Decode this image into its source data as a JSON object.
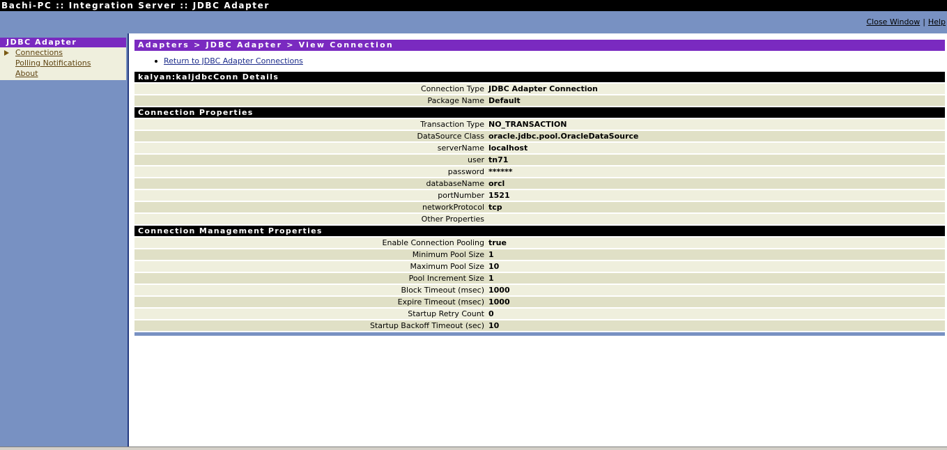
{
  "window": {
    "title": "Bachi-PC :: Integration Server :: JDBC Adapter"
  },
  "toplinks": {
    "close_window": "Close Window",
    "separator": "|",
    "help": "Help"
  },
  "sidebar": {
    "header": "JDBC Adapter",
    "items": [
      {
        "label": "Connections",
        "selected": true
      },
      {
        "label": "Polling Notifications",
        "selected": false
      },
      {
        "label": "About",
        "selected": false
      }
    ]
  },
  "main": {
    "breadcrumb": "Adapters > JDBC Adapter > View Connection",
    "return_link": "Return to JDBC Adapter Connections",
    "details": {
      "heading": "kalyan:kaljdbcConn Details",
      "rows": [
        {
          "label": "Connection Type",
          "value": "JDBC Adapter Connection"
        },
        {
          "label": "Package Name",
          "value": "Default"
        }
      ]
    },
    "connection_properties": {
      "heading": "Connection Properties",
      "rows": [
        {
          "label": "Transaction Type",
          "value": "NO_TRANSACTION"
        },
        {
          "label": "DataSource Class",
          "value": "oracle.jdbc.pool.OracleDataSource"
        },
        {
          "label": "serverName",
          "value": "localhost"
        },
        {
          "label": "user",
          "value": "tn71"
        },
        {
          "label": "password",
          "value": "******"
        },
        {
          "label": "databaseName",
          "value": "orcl"
        },
        {
          "label": "portNumber",
          "value": "1521"
        },
        {
          "label": "networkProtocol",
          "value": "tcp"
        },
        {
          "label": "Other Properties",
          "value": ""
        }
      ]
    },
    "management_properties": {
      "heading": "Connection Management Properties",
      "rows": [
        {
          "label": "Enable Connection Pooling",
          "value": "true"
        },
        {
          "label": "Minimum Pool Size",
          "value": "1"
        },
        {
          "label": "Maximum Pool Size",
          "value": "10"
        },
        {
          "label": "Pool Increment Size",
          "value": "1"
        },
        {
          "label": "Block Timeout (msec)",
          "value": "1000"
        },
        {
          "label": "Expire Timeout (msec)",
          "value": "1000"
        },
        {
          "label": "Startup Retry Count",
          "value": "0"
        },
        {
          "label": "Startup Backoff Timeout (sec)",
          "value": "10"
        }
      ]
    }
  },
  "colors": {
    "title_bar": "#000000",
    "band": "#7891c2",
    "accent_purple": "#7a2ac0",
    "row_light": "#efefdd",
    "row_dark": "#e0e0c6",
    "link_blue": "#1a2a8a",
    "sidebar_link": "#5e4310"
  }
}
